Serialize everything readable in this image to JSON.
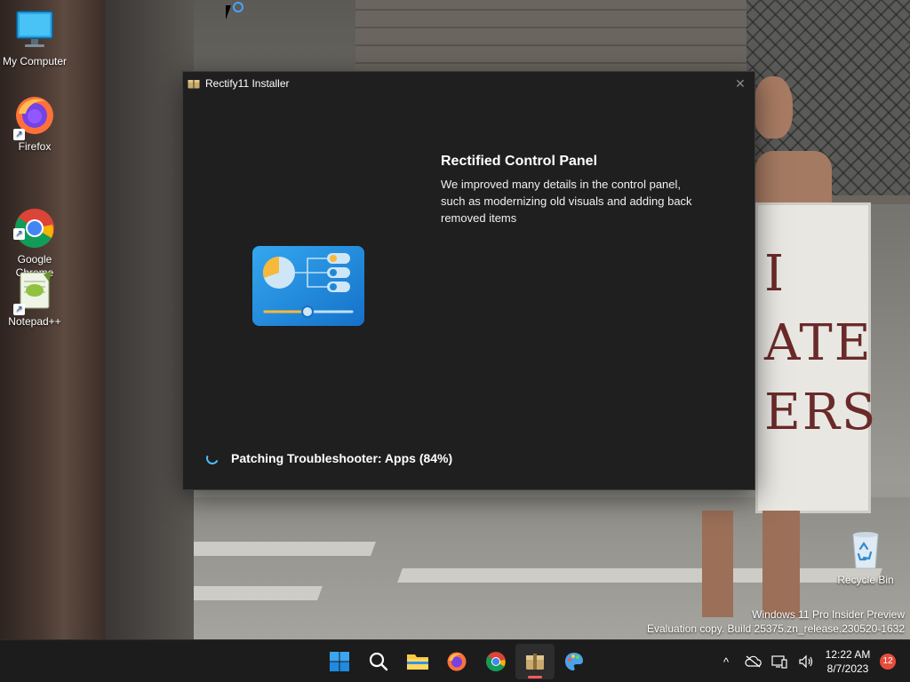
{
  "desktop": {
    "icons": [
      {
        "label": "My Computer",
        "icon": "monitor-icon"
      },
      {
        "label": "Firefox",
        "icon": "firefox-icon"
      },
      {
        "label": "Google\nChrome",
        "icon": "chrome-icon"
      },
      {
        "label": "Notepad++",
        "icon": "notepadpp-icon"
      },
      {
        "label": "Recycle Bin",
        "icon": "recycle-bin-icon"
      }
    ],
    "wallpaper_sign_text": "I\nATE\nERS"
  },
  "installer": {
    "title": "Rectify11 Installer",
    "close_glyph": "✕",
    "feature_title": "Rectified Control Panel",
    "feature_description": "We improved many details in the control panel, such as modernizing old visuals and adding back removed items",
    "status": "Patching Troubleshooter: Apps (84%)",
    "progress_percent": 84
  },
  "watermark": {
    "line1": "Windows 11 Pro Insider Preview",
    "line2": "Evaluation copy. Build 25375.zn_release.230520-1632"
  },
  "taskbar": {
    "apps": [
      {
        "name": "start-button",
        "icon": "windows-logo-icon"
      },
      {
        "name": "search-button",
        "icon": "search-icon"
      },
      {
        "name": "file-explorer-button",
        "icon": "folder-icon"
      },
      {
        "name": "firefox-button",
        "icon": "firefox-icon"
      },
      {
        "name": "chrome-button",
        "icon": "chrome-icon"
      },
      {
        "name": "installer-button",
        "icon": "package-icon",
        "active": true
      },
      {
        "name": "paint-button",
        "icon": "palette-icon"
      }
    ],
    "tray": {
      "chevron_glyph": "^",
      "time": "12:22 AM",
      "date": "8/7/2023",
      "notification_count": "12"
    }
  },
  "colors": {
    "accent": "#4cc2ff",
    "window_bg": "#1f1f1f",
    "taskbar_bg": "#1c1c1c",
    "badge": "#e74c3c"
  }
}
